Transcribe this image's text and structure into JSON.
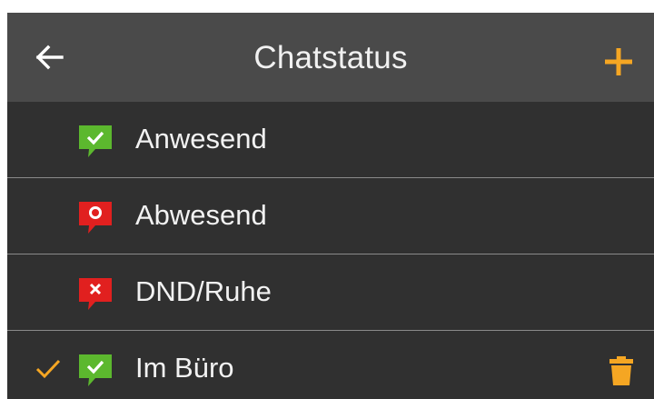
{
  "header": {
    "title": "Chatstatus",
    "back_icon": "arrow-left-icon",
    "add_icon": "plus-icon"
  },
  "colors": {
    "accent": "#f5a623",
    "available": "#5cb82e",
    "away": "#e1201f",
    "dnd": "#e1201f",
    "topbar_bg": "#4a4a4a",
    "list_bg": "#303030"
  },
  "statuses": [
    {
      "label": "Anwesend",
      "icon": "available-chat-icon",
      "selected": false,
      "deletable": false
    },
    {
      "label": "Abwesend",
      "icon": "away-chat-icon",
      "selected": false,
      "deletable": false
    },
    {
      "label": "DND/Ruhe",
      "icon": "dnd-chat-icon",
      "selected": false,
      "deletable": false
    },
    {
      "label": "Im Büro",
      "icon": "available-chat-icon",
      "selected": true,
      "deletable": true
    }
  ]
}
